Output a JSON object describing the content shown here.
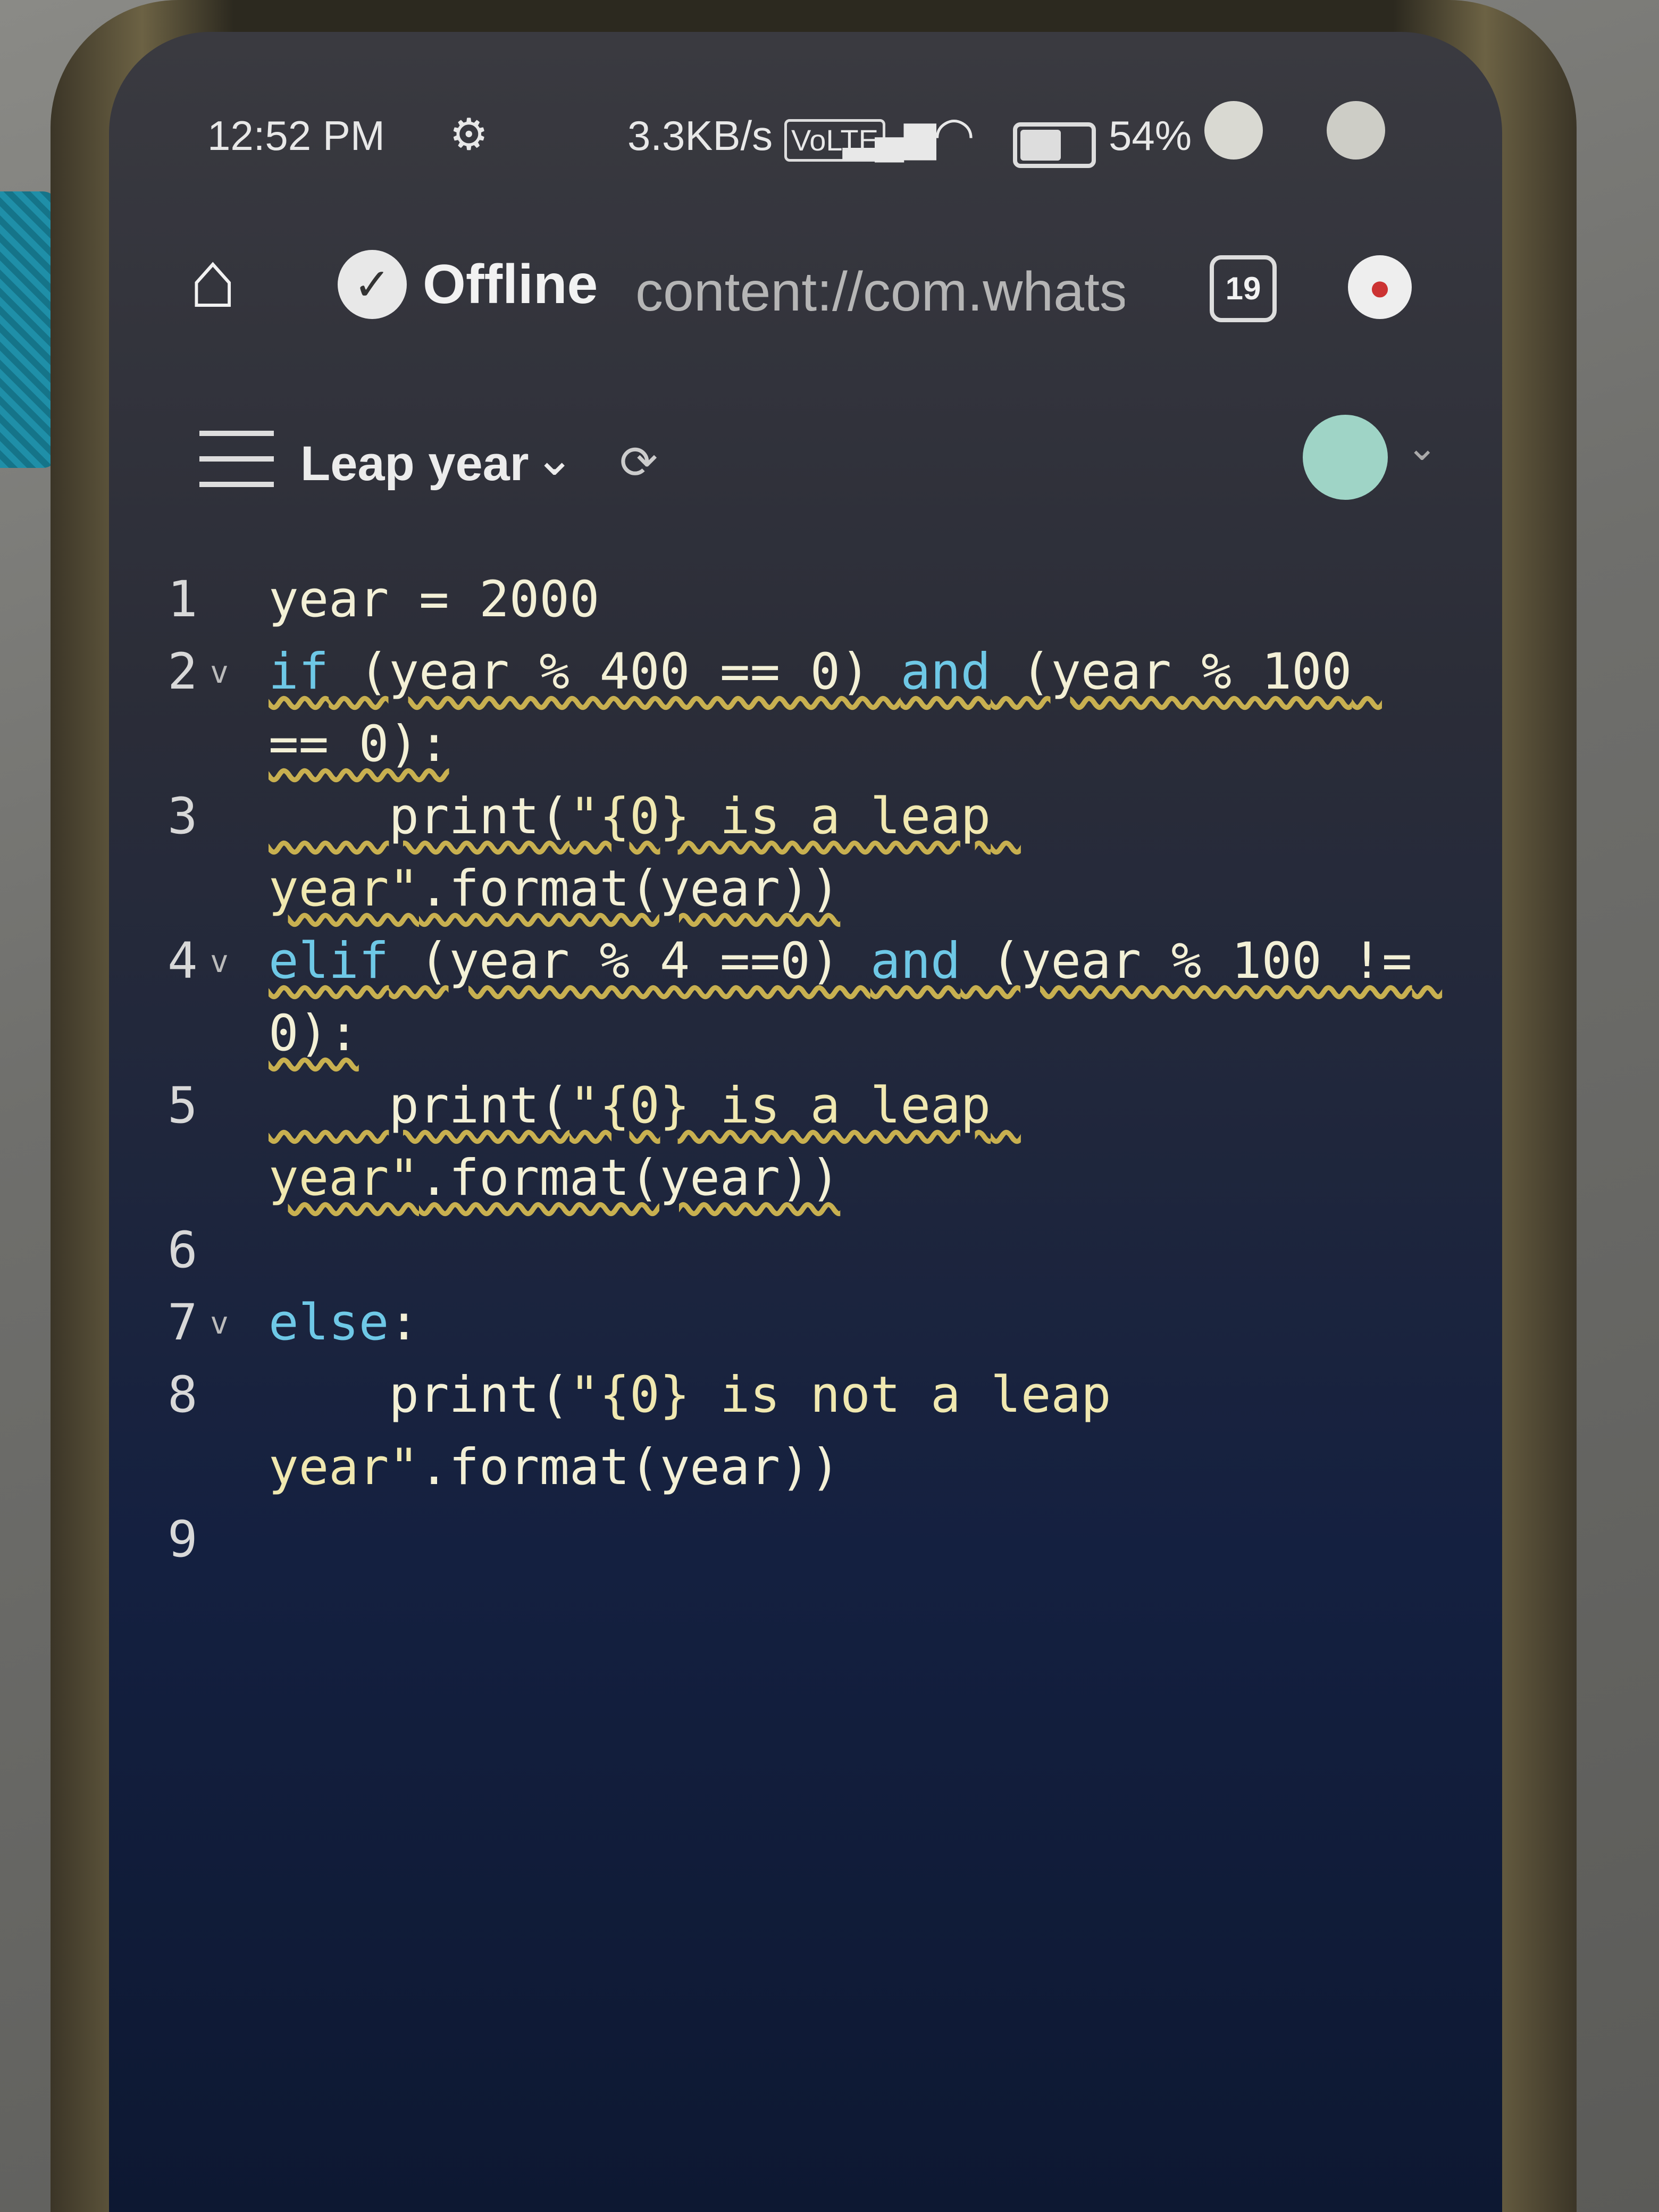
{
  "status_bar": {
    "time": "12:52 PM",
    "extra": "⬤⬤",
    "net_speed": "3.3KB/s",
    "sim": "VoLTE",
    "signal": "4G ▂▄▆█",
    "battery_percent": "54%",
    "battery_level": 0.54
  },
  "browser": {
    "status": "Offline",
    "url": "content://com.whats",
    "tab_count": "19"
  },
  "editor": {
    "title": "Leap year",
    "lines": [
      {
        "num": "1",
        "fold": "",
        "code": "year = 2000"
      },
      {
        "num": "2",
        "fold": "v",
        "code": "if (year % 400 == 0) and (year % 100 == 0):"
      },
      {
        "num": "3",
        "fold": "",
        "code": "    print(\"{0} is a leap year\".format(year))"
      },
      {
        "num": "4",
        "fold": "v",
        "code": "elif (year % 4 ==0) and (year % 100 != 0):"
      },
      {
        "num": "5",
        "fold": "",
        "code": "    print(\"{0} is a leap year\".format(year))"
      },
      {
        "num": "6",
        "fold": "",
        "code": ""
      },
      {
        "num": "7",
        "fold": "v",
        "code": "else:"
      },
      {
        "num": "8",
        "fold": "",
        "code": "    print(\"{0} is not a leap year\".format(year))"
      },
      {
        "num": "9",
        "fold": "",
        "code": ""
      }
    ]
  },
  "icons": {
    "home": "home-icon",
    "check": "check-icon",
    "sync": "sync-icon",
    "menu": "menu-icon",
    "gear": "gear-icon",
    "wifi": "wifi-icon"
  },
  "colors": {
    "keyword": "#6ec8e6",
    "code_text": "#f3f0d6",
    "warning_squiggle": "#c8b050"
  }
}
